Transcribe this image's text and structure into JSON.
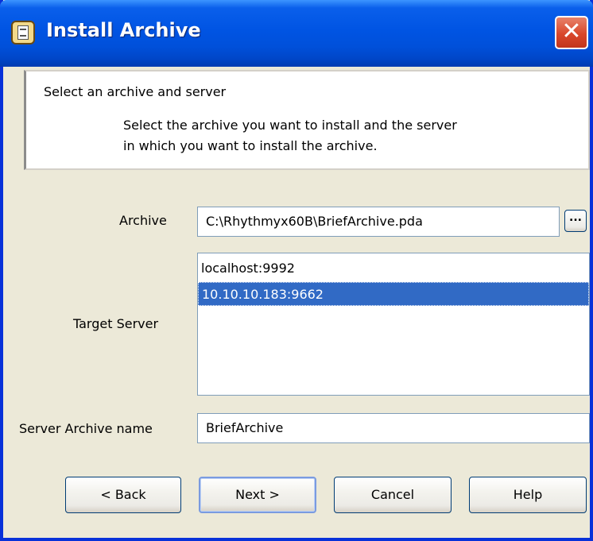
{
  "window": {
    "title": "Install Archive",
    "close_glyph": "✕"
  },
  "header": {
    "title": "Select an archive and server",
    "description_line1": "Select the archive you want to install and the server",
    "description_line2": "in which you want to install the archive."
  },
  "form": {
    "archive_label": "Archive",
    "archive_value": "C:\\Rhythmyx60B\\BriefArchive.pda",
    "browse_label": "...",
    "target_server_label": "Target Server",
    "servers": [
      {
        "label": "localhost:9992",
        "selected": false
      },
      {
        "label": "10.10.10.183:9662",
        "selected": true
      }
    ],
    "server_archive_name_label": "Server Archive name",
    "server_archive_name_value": "BriefArchive"
  },
  "buttons": {
    "back": "< Back",
    "next": "Next >",
    "cancel": "Cancel",
    "help": "Help"
  },
  "colors": {
    "titlebar": "#0054E3",
    "selection": "#316AC5",
    "dialog_bg": "#ECE9D8"
  }
}
